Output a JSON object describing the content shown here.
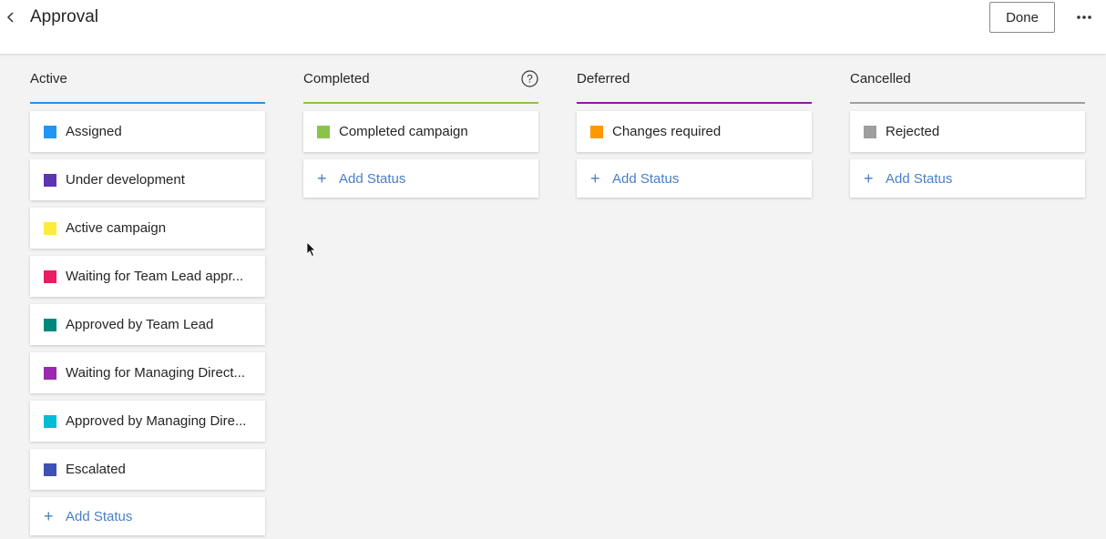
{
  "header": {
    "title": "Approval",
    "done_label": "Done",
    "back_icon": "chevron-left-icon",
    "more_icon": "ellipsis-icon"
  },
  "columns": [
    {
      "title": "Active",
      "accent": "#2e8ee0",
      "statuses": [
        {
          "label": "Assigned",
          "color": "#2196f3"
        },
        {
          "label": "Under development",
          "color": "#5e35b1"
        },
        {
          "label": "Active campaign",
          "color": "#ffeb3b"
        },
        {
          "label": "Waiting for Team Lead appr...",
          "color": "#e91e63"
        },
        {
          "label": "Approved by Team Lead",
          "color": "#00897b"
        },
        {
          "label": "Waiting for Managing Direct...",
          "color": "#9c27b0"
        },
        {
          "label": "Approved by Managing Dire...",
          "color": "#00bcd4"
        },
        {
          "label": "Escalated",
          "color": "#3f51b5"
        }
      ],
      "add_label": "Add Status"
    },
    {
      "title": "Completed",
      "accent": "#8bc34a",
      "help_icon": "question-circle-icon",
      "statuses": [
        {
          "label": "Completed campaign",
          "color": "#8bc34a"
        }
      ],
      "add_label": "Add Status"
    },
    {
      "title": "Deferred",
      "accent": "#8e1aa0",
      "statuses": [
        {
          "label": "Changes required",
          "color": "#ff9800"
        }
      ],
      "add_label": "Add Status"
    },
    {
      "title": "Cancelled",
      "accent": "#9e9e9e",
      "statuses": [
        {
          "label": "Rejected",
          "color": "#9e9e9e"
        }
      ],
      "add_label": "Add Status"
    }
  ]
}
